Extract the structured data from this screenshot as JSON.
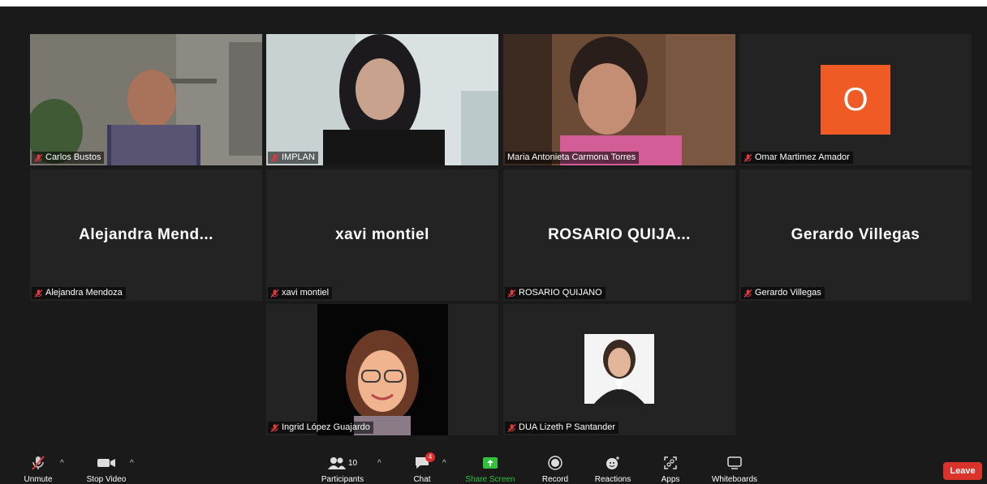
{
  "participants": [
    {
      "name": "Carlos Bustos",
      "muted": true
    },
    {
      "name": "IMPLAN",
      "muted": true,
      "active": true
    },
    {
      "name": "Maria Antonieta Carmona Torres",
      "muted": false
    },
    {
      "name": "Omar Martimez Amador",
      "muted": true,
      "avatar_letter": "O"
    },
    {
      "name": "Alejandra Mendoza",
      "display": "Alejandra  Mend...",
      "muted": true
    },
    {
      "name": "xavi montiel",
      "display": "xavi montiel",
      "muted": true
    },
    {
      "name": "ROSARIO QUIJANO",
      "display": "ROSARIO  QUIJA...",
      "muted": true
    },
    {
      "name": "Gerardo Villegas",
      "display": "Gerardo Villegas",
      "muted": true
    },
    {
      "name": "Ingrid López Guajardo",
      "muted": true
    },
    {
      "name": "DUA Lizeth P Santander",
      "muted": true
    }
  ],
  "toolbar": {
    "unmute": "Unmute",
    "stop_video": "Stop Video",
    "participants": "Participants",
    "participants_count": "10",
    "chat": "Chat",
    "chat_badge": "4",
    "share_screen": "Share Screen",
    "record": "Record",
    "reactions": "Reactions",
    "apps": "Apps",
    "whiteboards": "Whiteboards",
    "leave": "Leave"
  },
  "colors": {
    "accent": "#2ec23a",
    "active_border": "#d5e27a",
    "leave": "#d9332b",
    "avatar_O": "#f05a24",
    "mic_muted": "#e0393e"
  }
}
